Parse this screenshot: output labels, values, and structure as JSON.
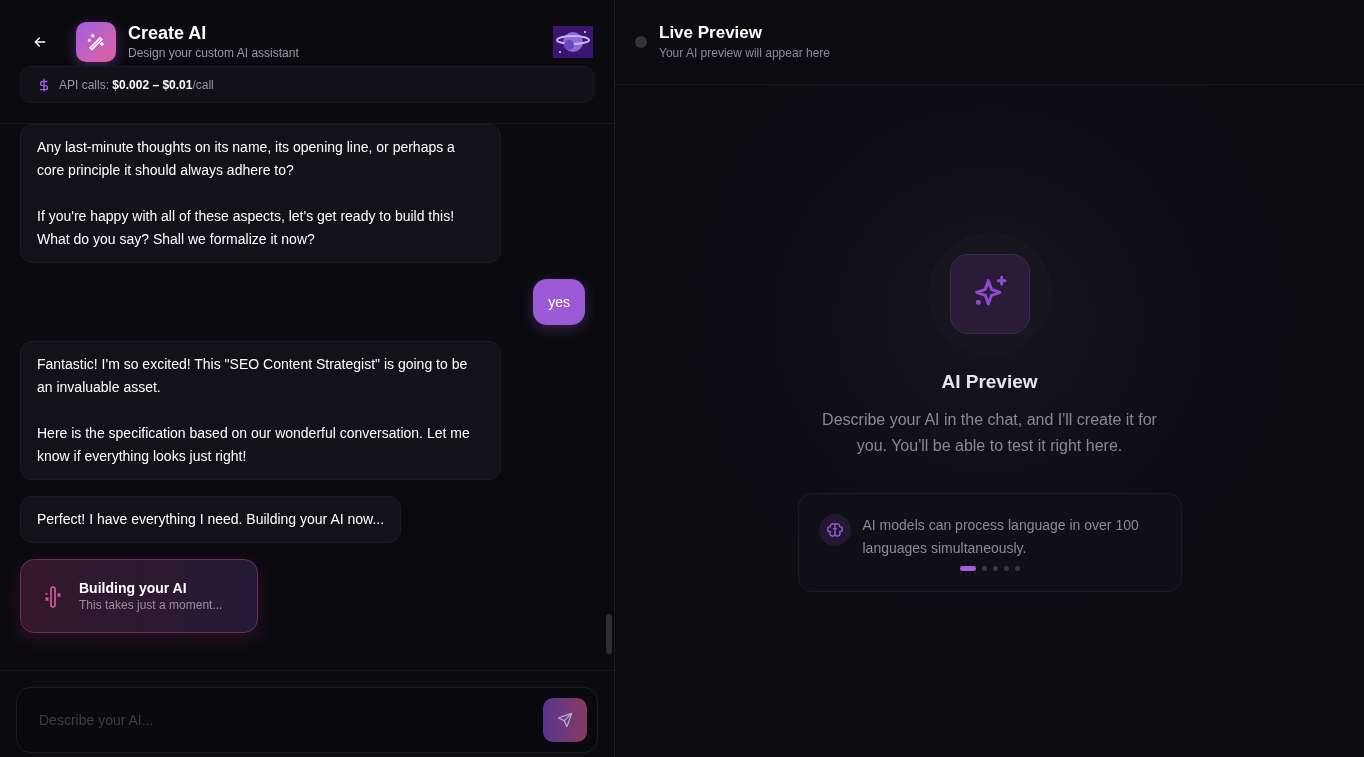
{
  "header": {
    "title": "Create AI",
    "subtitle": "Design your custom AI assistant"
  },
  "cost": {
    "label": "API calls:",
    "range": "$0.002 – $0.01",
    "unit": "/call"
  },
  "messages": [
    {
      "kind": "assistant",
      "paragraphs": [
        "Any last-minute thoughts on its name, its opening line, or perhaps a core principle it should always adhere to?",
        "If you're happy with all of these aspects, let's get ready to build this! What do you say? Shall we formalize it now?"
      ]
    },
    {
      "kind": "user",
      "paragraphs": [
        "yes"
      ]
    },
    {
      "kind": "assistant",
      "paragraphs": [
        "Fantastic! I'm so excited! This \"SEO Content Strategist\" is going to be an invaluable asset.",
        "Here is the specification based on our wonderful conversation. Let me know if everything looks just right!"
      ]
    },
    {
      "kind": "assistant",
      "paragraphs": [
        "Perfect! I have everything I need. Building your AI now..."
      ]
    }
  ],
  "building": {
    "title": "Building your AI",
    "subtitle": "This takes just a moment..."
  },
  "composer": {
    "placeholder": "Describe your AI..."
  },
  "preview": {
    "title": "Live Preview",
    "subtitle": "Your AI preview will appear here",
    "live": false,
    "heading": "AI Preview",
    "description": "Describe your AI in the chat, and I'll create it for you. You'll be able to test it right here.",
    "tip": "AI models can process language in over 100 languages simultaneously.",
    "dots": [
      {
        "selected": true
      },
      {
        "selected": false
      },
      {
        "selected": false
      },
      {
        "selected": false
      },
      {
        "selected": false
      }
    ]
  }
}
